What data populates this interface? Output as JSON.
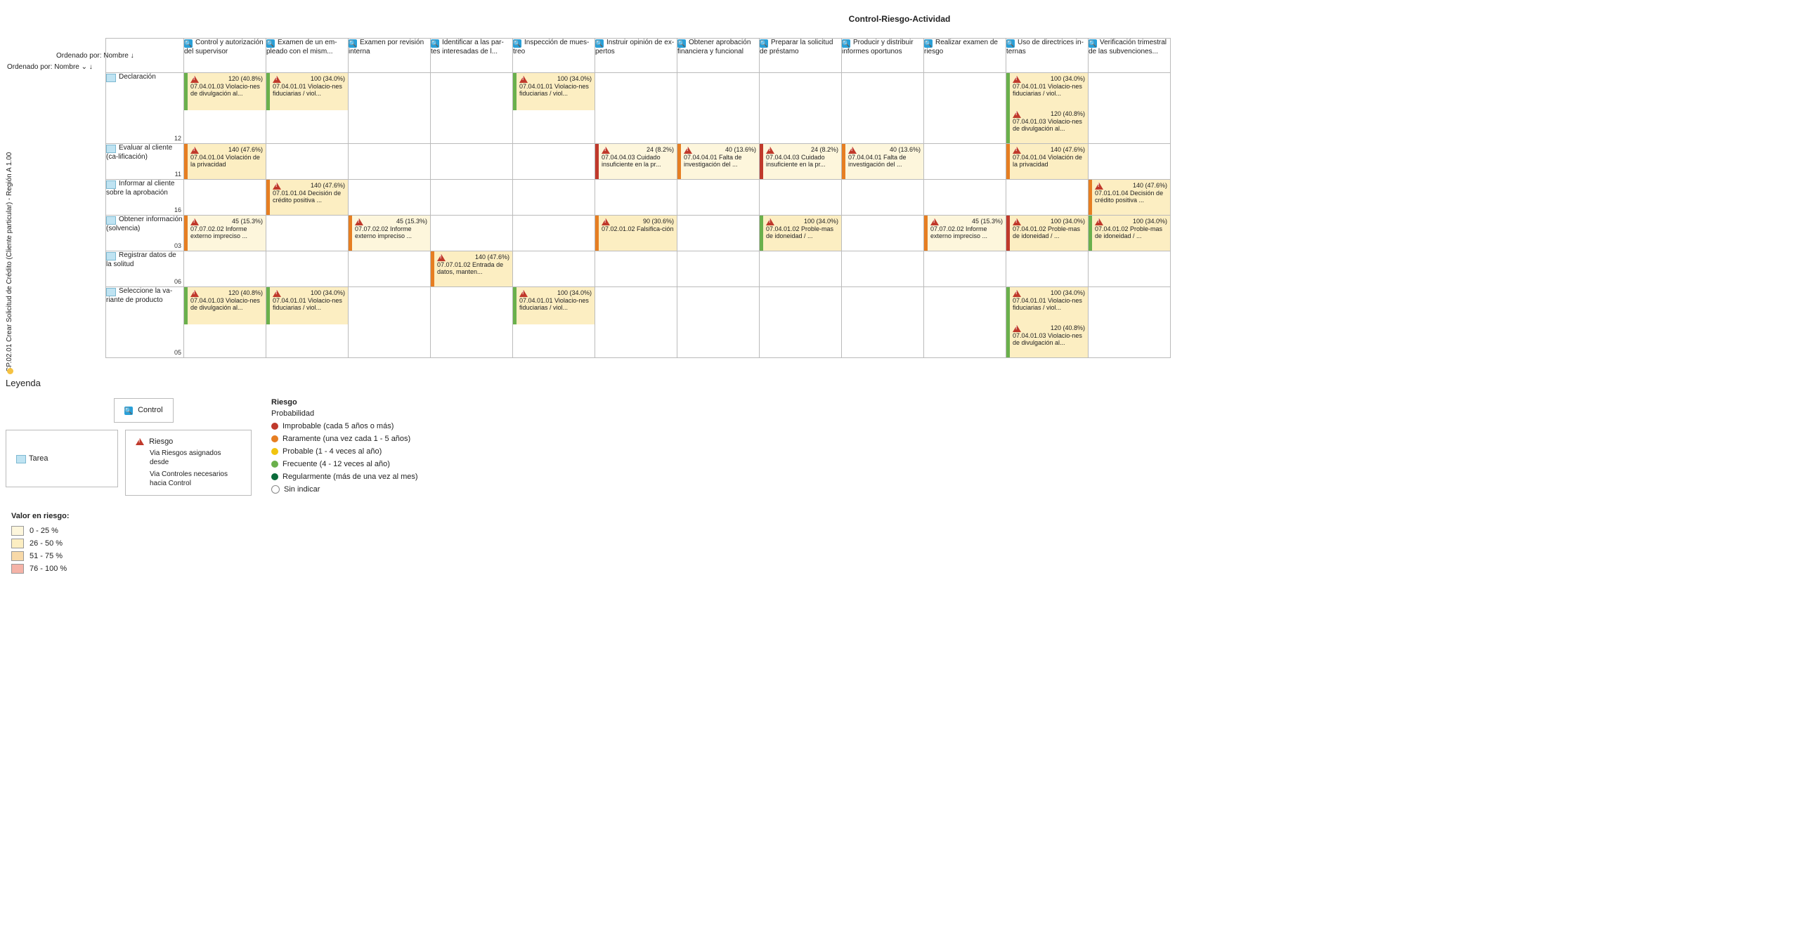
{
  "title": "Control-Riesgo-Actividad",
  "sort": {
    "col_label": "Ordenado por: Nombre",
    "row_label": "Ordenado por: Nombre",
    "arrow": "↓"
  },
  "vertical_axis": "CP.02.01 Crear Solicitud de Crédito (Cliente particular) - Región A 1.00",
  "columns": [
    "Control y autorización del supervisor",
    "Examen de un em-pleado con el mism...",
    "Examen por revisión interna",
    "Identificar a las par-tes interesadas de l...",
    "Inspección de mues-treo",
    "Instruir opinión de ex-pertos",
    "Obtener aprobación financiera y funcional",
    "Preparar la solicitud de préstamo",
    "Producir y distribuir informes oportunos",
    "Realizar examen de riesgo",
    "Uso de directrices in-ternas",
    "Verificación trimestral de las subvenciones..."
  ],
  "rows": [
    {
      "label": "Declaración",
      "idx": "12",
      "tall": true
    },
    {
      "label": "Evaluar al cliente (ca-lificación)",
      "idx": "11",
      "tall": false
    },
    {
      "label": "Informar al cliente sobre la aprobación",
      "idx": "16",
      "tall": false
    },
    {
      "label": "Obtener información (solvencia)",
      "idx": "03",
      "tall": false
    },
    {
      "label": "Registrar datos de la solitud",
      "idx": "06",
      "tall": false
    },
    {
      "label": "Seleccione la va-riante de producto",
      "idx": "05",
      "tall": true
    }
  ],
  "cells": {
    "0,0": [
      {
        "value": "120 (40.8%)",
        "desc": "07.04.01.03 Violacio-nes de divulgación al...",
        "sev": 2,
        "prob": "frecuente"
      }
    ],
    "0,1": [
      {
        "value": "100 (34.0%)",
        "desc": "07.04.01.01 Violacio-nes fiduciarias / viol...",
        "sev": 2,
        "prob": "frecuente"
      }
    ],
    "0,4": [
      {
        "value": "100 (34.0%)",
        "desc": "07.04.01.01 Violacio-nes fiduciarias / viol...",
        "sev": 2,
        "prob": "frecuente"
      }
    ],
    "0,10": [
      {
        "value": "100 (34.0%)",
        "desc": "07.04.01.01 Violacio-nes fiduciarias / viol...",
        "sev": 2,
        "prob": "frecuente"
      },
      {
        "value": "120 (40.8%)",
        "desc": "07.04.01.03 Violacio-nes de divulgación al...",
        "sev": 2,
        "prob": "frecuente"
      }
    ],
    "1,0": [
      {
        "value": "140 (47.6%)",
        "desc": "07.04.01.04 Violación de la privacidad",
        "sev": 2,
        "prob": "raramente"
      }
    ],
    "1,5": [
      {
        "value": "24 (8.2%)",
        "desc": "07.04.04.03 Cuidado insuficiente en la pr...",
        "sev": 1,
        "prob": "improbable"
      }
    ],
    "1,6": [
      {
        "value": "40 (13.6%)",
        "desc": "07.04.04.01 Falta de investigación del ...",
        "sev": 1,
        "prob": "raramente"
      }
    ],
    "1,7": [
      {
        "value": "24 (8.2%)",
        "desc": "07.04.04.03 Cuidado insuficiente en la pr...",
        "sev": 1,
        "prob": "improbable"
      }
    ],
    "1,8": [
      {
        "value": "40 (13.6%)",
        "desc": "07.04.04.01 Falta de investigación del ...",
        "sev": 1,
        "prob": "raramente"
      }
    ],
    "1,10": [
      {
        "value": "140 (47.6%)",
        "desc": "07.04.01.04 Violación de la privacidad",
        "sev": 2,
        "prob": "raramente"
      }
    ],
    "2,1": [
      {
        "value": "140 (47.6%)",
        "desc": "07.01.01.04 Decisión de crédito positiva ...",
        "sev": 2,
        "prob": "raramente"
      }
    ],
    "2,11": [
      {
        "value": "140 (47.6%)",
        "desc": "07.01.01.04 Decisión de crédito positiva ...",
        "sev": 2,
        "prob": "raramente"
      }
    ],
    "3,0": [
      {
        "value": "45 (15.3%)",
        "desc": "07.07.02.02 Informe externo impreciso ...",
        "sev": 1,
        "prob": "raramente"
      }
    ],
    "3,2": [
      {
        "value": "45 (15.3%)",
        "desc": "07.07.02.02 Informe externo impreciso ...",
        "sev": 1,
        "prob": "raramente"
      }
    ],
    "3,5": [
      {
        "value": "90 (30.6%)",
        "desc": "07.02.01.02 Falsifica-ción",
        "sev": 2,
        "prob": "raramente"
      }
    ],
    "3,7": [
      {
        "value": "100 (34.0%)",
        "desc": "07.04.01.02 Proble-mas de idoneidad / ...",
        "sev": 2,
        "prob": "frecuente"
      }
    ],
    "3,9": [
      {
        "value": "45 (15.3%)",
        "desc": "07.07.02.02 Informe externo impreciso ...",
        "sev": 1,
        "prob": "raramente"
      }
    ],
    "3,10": [
      {
        "value": "100 (34.0%)",
        "desc": "07.04.01.02 Proble-mas de idoneidad / ...",
        "sev": 2,
        "prob": "improbable"
      }
    ],
    "3,11": [
      {
        "value": "100 (34.0%)",
        "desc": "07.04.01.02 Proble-mas de idoneidad / ...",
        "sev": 2,
        "prob": "frecuente"
      }
    ],
    "4,3": [
      {
        "value": "140 (47.6%)",
        "desc": "07.07.01.02 Entrada de datos, manten...",
        "sev": 2,
        "prob": "raramente"
      }
    ],
    "5,0": [
      {
        "value": "120 (40.8%)",
        "desc": "07.04.01.03 Violacio-nes de divulgación al...",
        "sev": 2,
        "prob": "frecuente"
      }
    ],
    "5,1": [
      {
        "value": "100 (34.0%)",
        "desc": "07.04.01.01 Violacio-nes fiduciarias / viol...",
        "sev": 2,
        "prob": "frecuente"
      }
    ],
    "5,4": [
      {
        "value": "100 (34.0%)",
        "desc": "07.04.01.01 Violacio-nes fiduciarias / viol...",
        "sev": 2,
        "prob": "frecuente"
      }
    ],
    "5,10": [
      {
        "value": "100 (34.0%)",
        "desc": "07.04.01.01 Violacio-nes fiduciarias / viol...",
        "sev": 2,
        "prob": "frecuente"
      },
      {
        "value": "120 (40.8%)",
        "desc": "07.04.01.03 Violacio-nes de divulgación al...",
        "sev": 2,
        "prob": "frecuente"
      }
    ]
  },
  "legend": {
    "title": "Leyenda",
    "task": "Tarea",
    "control": "Control",
    "risk": "Riesgo",
    "risk_sub1": "Via Riesgos asignados desde",
    "risk_sub2": "Via Controles necesarios hacia Control",
    "prob_title": "Riesgo",
    "prob_sub": "Probabilidad",
    "prob": [
      "Improbable (cada 5 años o más)",
      "Raramente (una vez cada 1 - 5 años)",
      "Probable (1 - 4 veces al año)",
      "Frecuente (4 - 12 veces al año)",
      "Regularmente (más de una vez al mes)",
      "Sin indicar"
    ],
    "var_title": "Valor en riesgo:",
    "var": [
      "0 - 25 %",
      "26 - 50 %",
      "51 - 75 %",
      "76 - 100 %"
    ]
  }
}
